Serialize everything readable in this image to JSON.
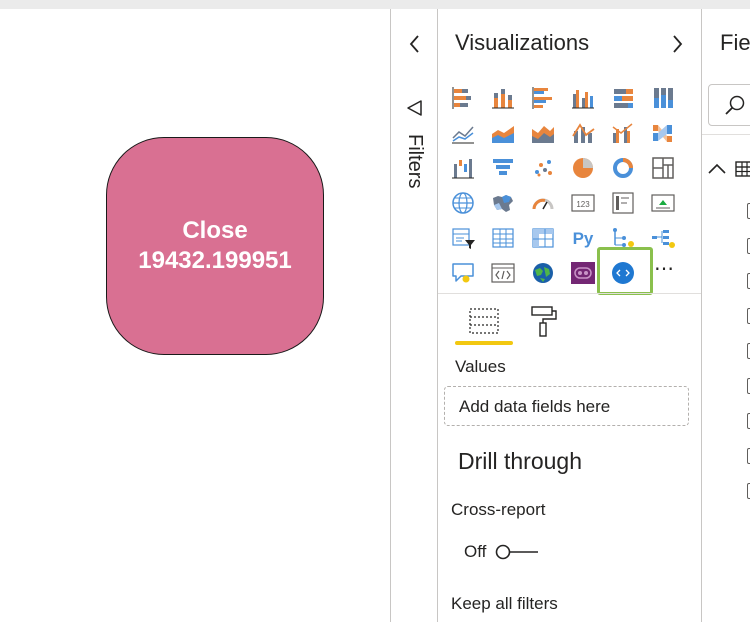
{
  "card": {
    "line1": "Close",
    "line2": "19432.199951"
  },
  "filters": {
    "label": "Filters"
  },
  "visualizations": {
    "title": "Visualizations",
    "icons": [
      "stacked-bar-chart-icon",
      "stacked-column-chart-icon",
      "clustered-bar-chart-icon",
      "clustered-column-chart-icon",
      "100-stacked-bar-chart-icon",
      "100-stacked-column-chart-icon",
      "line-chart-icon",
      "area-chart-icon",
      "stacked-area-chart-icon",
      "line-and-stacked-column-chart-icon",
      "line-and-clustered-column-chart-icon",
      "ribbon-chart-icon",
      "waterfall-chart-icon",
      "funnel-chart-icon",
      "scatter-chart-icon",
      "pie-chart-icon",
      "donut-chart-icon",
      "treemap-icon",
      "map-icon",
      "filled-map-icon",
      "gauge-icon",
      "card-icon",
      "multi-row-card-icon",
      "kpi-icon",
      "slicer-icon",
      "table-icon",
      "matrix-icon",
      "python-visual-icon",
      "key-influencers-icon",
      "decomposition-tree-icon",
      "qa-icon",
      "smart-narrative-icon",
      "arcgis-map-icon",
      "power-apps-icon",
      "custom-visual-icon"
    ],
    "python_label": "Py",
    "card_number_label": "123",
    "more_label": "⋯",
    "tabs": [
      "fields-tab",
      "format-tab"
    ],
    "values_label": "Values",
    "dropzone_label": "Add data fields here",
    "drill_through_label": "Drill through",
    "cross_report_label": "Cross-report",
    "toggle_state": "Off",
    "keep_filters_label": "Keep all filters"
  },
  "fields": {
    "title": "Fields"
  },
  "colors": {
    "card_fill": "#d97092",
    "highlight": "#8ac04d",
    "accent_underline": "#f2c811",
    "chart_orange": "#e8853d",
    "chart_blue": "#4a90d9",
    "chart_gray": "#6b7a8f"
  }
}
